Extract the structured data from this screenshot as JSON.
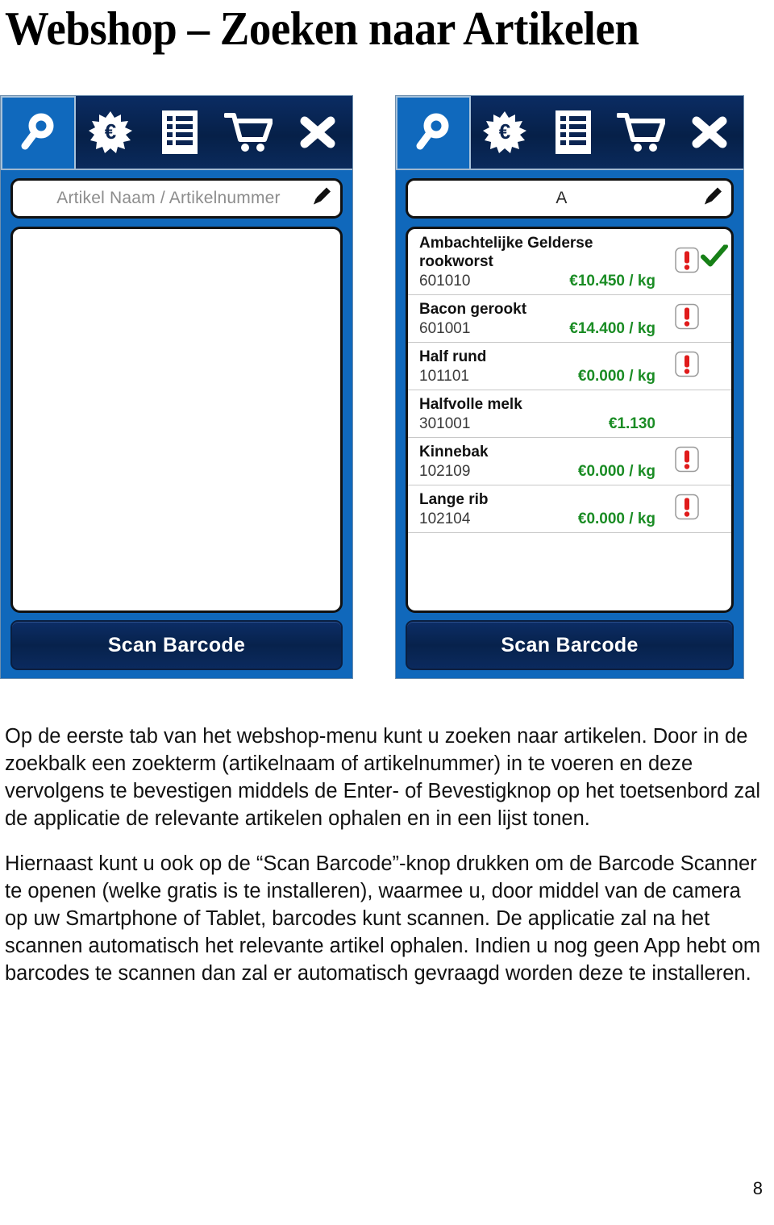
{
  "document": {
    "title": "Webshop – Zoeken naar Artikelen",
    "page_number": "8"
  },
  "colors": {
    "panel_blue": "#1068bb",
    "toolbar_navy": "#062048",
    "active_tab_blue": "#1069bd",
    "price_green": "#1a8c24",
    "warning_red": "#e01b1b",
    "check_green": "#178017"
  },
  "toolbar": {
    "tabs": [
      {
        "icon": "search-icon",
        "label": "Zoeken",
        "active": true
      },
      {
        "icon": "euro-burst-icon",
        "label": "Aanbiedingen",
        "active": false
      },
      {
        "icon": "list-icon",
        "label": "Lijst",
        "active": false
      },
      {
        "icon": "cart-icon",
        "label": "Winkelwagen",
        "active": false
      },
      {
        "icon": "close-icon",
        "label": "Sluiten",
        "active": false
      }
    ]
  },
  "screenshots": [
    {
      "id": "left",
      "search": {
        "value": "",
        "placeholder": "Artikel Naam / Artikelnummer",
        "edit_icon": "pencil-icon"
      },
      "results": [],
      "scan_button": {
        "label": "Scan Barcode"
      }
    },
    {
      "id": "right",
      "search": {
        "value": "A",
        "placeholder": "Artikel Naam / Artikelnummer",
        "edit_icon": "pencil-icon"
      },
      "results": [
        {
          "name": "Ambachtelijke Gelderse rookworst",
          "code": "601010",
          "price": "€10.450 / kg",
          "warning": true,
          "selected": true
        },
        {
          "name": "Bacon gerookt",
          "code": "601001",
          "price": "€14.400 / kg",
          "warning": true,
          "selected": false
        },
        {
          "name": "Half rund",
          "code": "101101",
          "price": "€0.000 / kg",
          "warning": true,
          "selected": false
        },
        {
          "name": "Halfvolle melk",
          "code": "301001",
          "price": "€1.130",
          "warning": false,
          "selected": false
        },
        {
          "name": "Kinnebak",
          "code": "102109",
          "price": "€0.000 / kg",
          "warning": true,
          "selected": false
        },
        {
          "name": "Lange rib",
          "code": "102104",
          "price": "€0.000 / kg",
          "warning": true,
          "selected": false
        }
      ],
      "scan_button": {
        "label": "Scan Barcode"
      }
    }
  ],
  "body": {
    "paragraphs": [
      "Op de eerste tab van het webshop-menu kunt u zoeken naar artikelen. Door in de zoekbalk een zoekterm (artikelnaam of artikelnummer) in te voeren en deze vervolgens te bevestigen middels de Enter- of Bevestigknop op het toetsenbord zal de applicatie de relevante artikelen ophalen en in een lijst tonen.",
      "Hiernaast kunt u ook op de “Scan Barcode”-knop drukken om de Barcode Scanner te openen (welke gratis is te installeren), waarmee u, door middel van de camera op uw Smartphone of Tablet, barcodes kunt scannen. De applicatie zal na het scannen automatisch het relevante artikel ophalen. Indien u nog geen App hebt om barcodes te scannen dan zal er automatisch gevraagd worden deze te installeren."
    ]
  }
}
